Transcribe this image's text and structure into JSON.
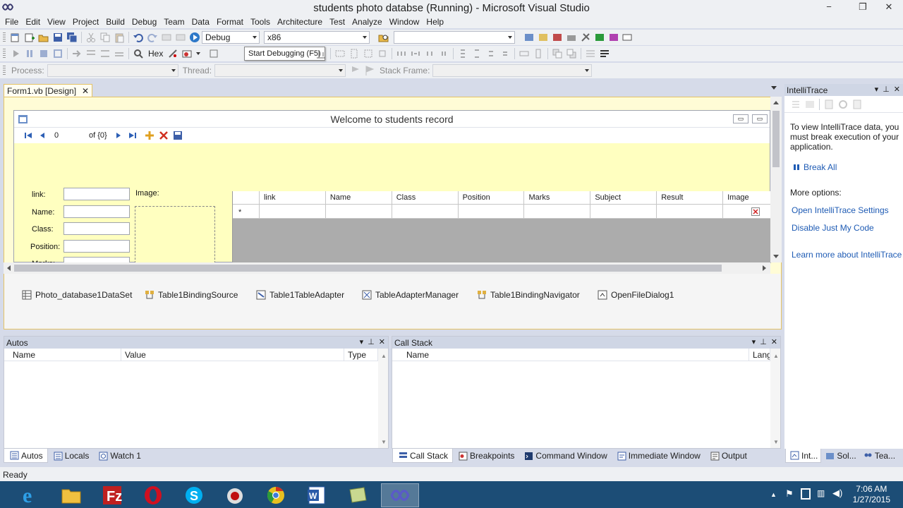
{
  "window": {
    "title": "students photo databse (Running) - Microsoft Visual Studio",
    "minimize": "−",
    "restore": "❐",
    "close": "✕"
  },
  "menu": [
    "File",
    "Edit",
    "View",
    "Project",
    "Build",
    "Debug",
    "Team",
    "Data",
    "Format",
    "Tools",
    "Architecture",
    "Test",
    "Analyze",
    "Window",
    "Help"
  ],
  "toolbar1": {
    "config": "Debug",
    "platform": "x86",
    "find": ""
  },
  "toolbar2": {
    "hex_label": "Hex",
    "tooltip": "Start Debugging (F5)"
  },
  "toolbar3": {
    "process_label": "Process:",
    "thread_label": "Thread:",
    "stackframe_label": "Stack Frame:"
  },
  "doc_tab": {
    "label": "Form1.vb [Design]",
    "close": "✕"
  },
  "form": {
    "title": "Welcome to students record",
    "navigator": {
      "position": "0",
      "count": "of {0}"
    },
    "fields": {
      "link": "link:",
      "name": "Name:",
      "class": "Class:",
      "position": "Position:",
      "marks": "Marks:",
      "image": "Image:"
    },
    "grid": {
      "columns": [
        "link",
        "Name",
        "Class",
        "Position",
        "Marks",
        "Subject",
        "Result",
        "Image"
      ],
      "new_row_marker": "*"
    }
  },
  "tray": [
    "Photo_database1DataSet",
    "Table1BindingSource",
    "Table1TableAdapter",
    "TableAdapterManager",
    "Table1BindingNavigator",
    "OpenFileDialog1"
  ],
  "autos": {
    "title": "Autos",
    "columns": [
      "Name",
      "Value",
      "Type"
    ],
    "tabs": [
      "Autos",
      "Locals",
      "Watch 1"
    ]
  },
  "callstack": {
    "title": "Call Stack",
    "columns": [
      "Name",
      "Lang"
    ],
    "tabs": [
      "Call Stack",
      "Breakpoints",
      "Command Window",
      "Immediate Window",
      "Output"
    ]
  },
  "intellitrace": {
    "title": "IntelliTrace",
    "message": "To view IntelliTrace data, you must break execution of your application.",
    "break_all": "Break All",
    "more_options": "More options:",
    "links": [
      "Open IntelliTrace Settings",
      "Disable Just My Code",
      "Learn more about IntelliTrace"
    ],
    "tabs": [
      "Int...",
      "Sol...",
      "Tea..."
    ]
  },
  "status": {
    "text": "Ready"
  },
  "taskbar": {
    "time": "7:06 AM",
    "date": "1/27/2015"
  },
  "colors": {
    "accent": "#1c4d76",
    "designer_bg": "#fffcd6",
    "form_bg": "#ffffc0",
    "link": "#1e5bb4",
    "panel_header": "#cfd6e5"
  }
}
